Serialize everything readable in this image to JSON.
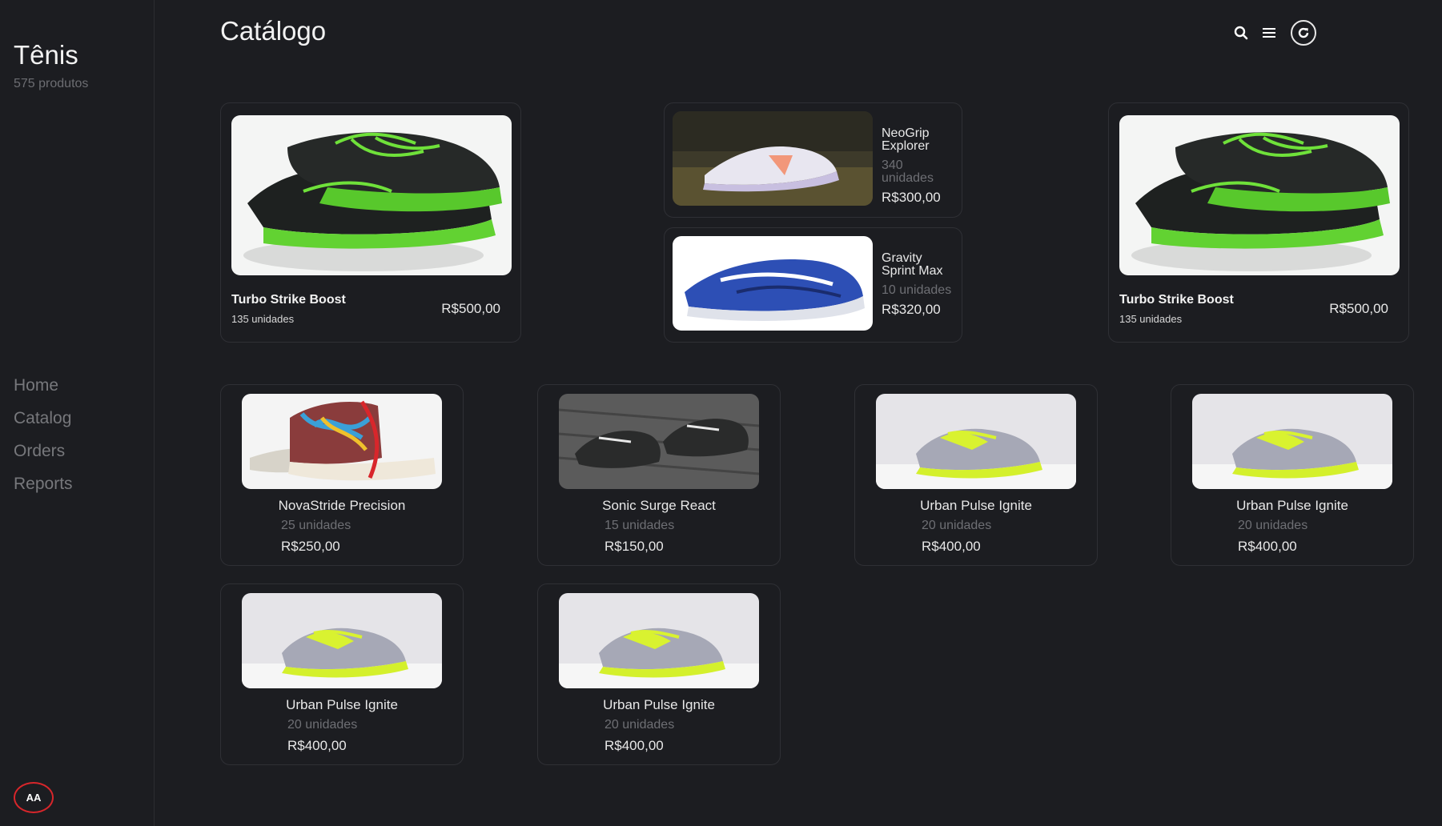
{
  "sidebar": {
    "title": "Tênis",
    "subtitle": "575 produtos",
    "nav": [
      "Home",
      "Catalog",
      "Orders",
      "Reports"
    ],
    "avatar": "AA"
  },
  "header": {
    "title": "Catálogo",
    "icons": [
      "search-icon",
      "menu-icon",
      "refresh-icon"
    ]
  },
  "featured": [
    {
      "name": "Turbo Strike Boost",
      "units": "135 unidades",
      "price": "R$500,00",
      "image": "black-green-sneakers"
    },
    {
      "name": "Turbo Strike Boost",
      "units": "135 unidades",
      "price": "R$500,00",
      "image": "black-green-sneakers"
    }
  ],
  "mini": [
    {
      "name_line1": "NeoGrip",
      "name_line2": "Explorer",
      "units_line1": "340",
      "units_line2": "unidades",
      "price": "R$300,00",
      "image": "white-pastel-sneaker"
    },
    {
      "name_line1": "Gravity",
      "name_line2": "Sprint Max",
      "units": "10 unidades",
      "price": "R$320,00",
      "image": "blue-running-shoe"
    }
  ],
  "grid": [
    {
      "name": "NovaStride Precision",
      "units": "25 unidades",
      "price": "R$250,00",
      "image": "graffiti-high-tops"
    },
    {
      "name": "Sonic Surge React",
      "units": "15 unidades",
      "price": "R$150,00",
      "image": "dark-sneakers-wood"
    },
    {
      "name": "Urban Pulse Ignite",
      "units": "20 unidades",
      "price": "R$400,00",
      "image": "grey-volt-sneaker"
    },
    {
      "name": "Urban Pulse Ignite",
      "units": "20 unidades",
      "price": "R$400,00",
      "image": "grey-volt-sneaker"
    },
    {
      "name": "Urban Pulse Ignite",
      "units": "20 unidades",
      "price": "R$400,00",
      "image": "grey-volt-sneaker"
    },
    {
      "name": "Urban Pulse Ignite",
      "units": "20 unidades",
      "price": "R$400,00",
      "image": "grey-volt-sneaker"
    }
  ],
  "colors": {
    "background": "#1c1d21",
    "card_border": "#2f3035",
    "muted": "#6e6f74",
    "avatar_ring": "#d8262b"
  }
}
